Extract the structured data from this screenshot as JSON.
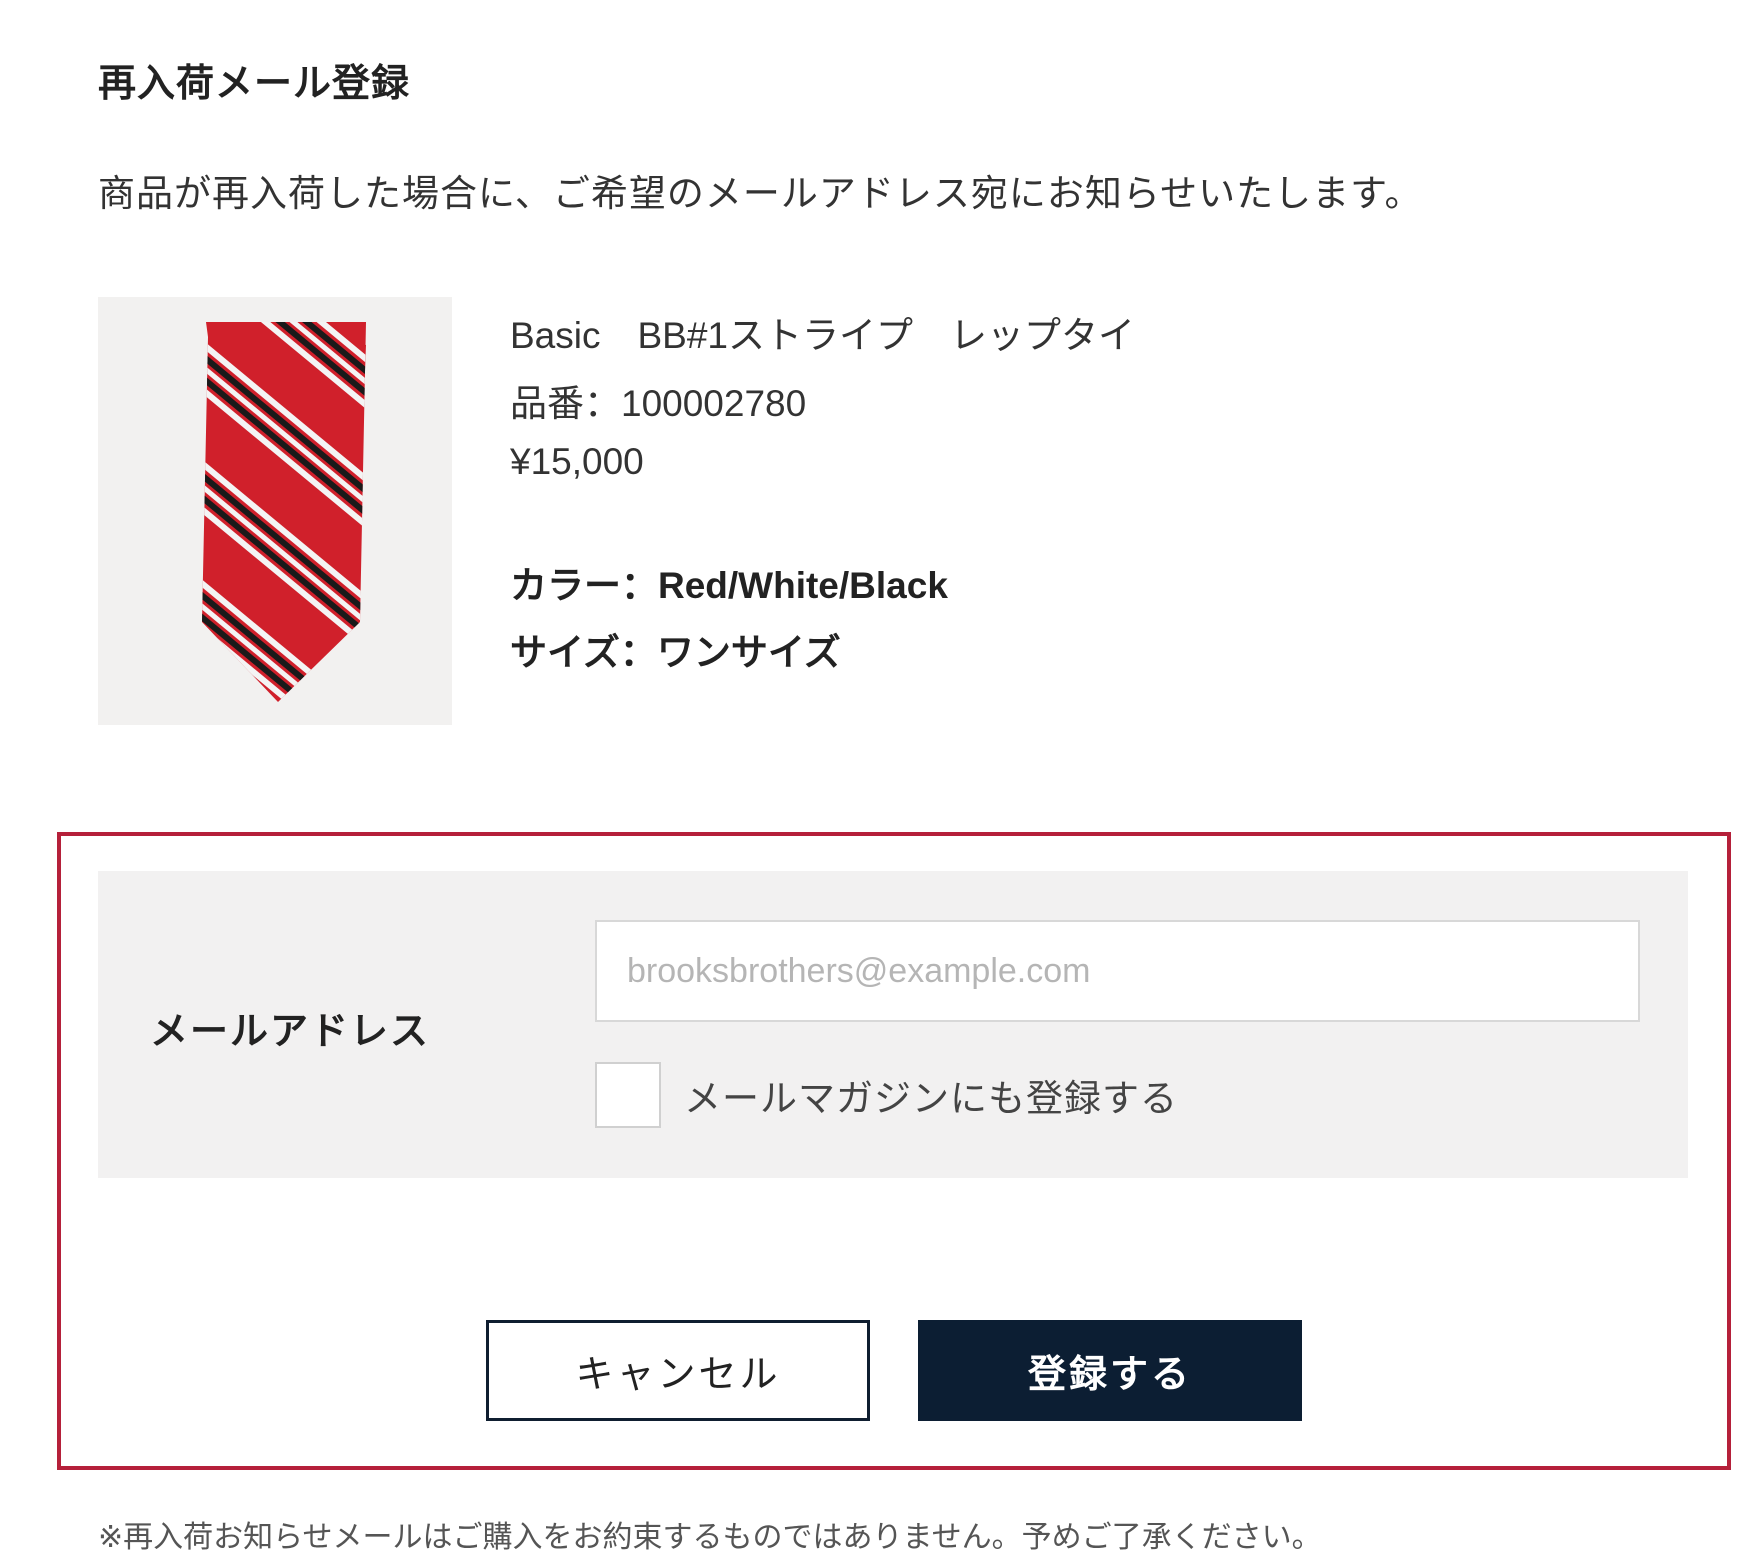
{
  "page": {
    "title": "再入荷メール登録",
    "intro": "商品が再入荷した場合に、ご希望のメールアドレス宛にお知らせいたします。"
  },
  "product": {
    "name": "Basic　BB#1ストライプ　レップタイ",
    "sku": "品番：100002780",
    "price": "¥15,000",
    "color": "カラー：Red/White/Black",
    "size": "サイズ：ワンサイズ",
    "image_icon": "striped-necktie-image"
  },
  "form": {
    "email_label": "メールアドレス",
    "email_placeholder": "brooksbrothers@example.com",
    "email_value": "",
    "newsletter_label": "メールマガジンにも登録する",
    "newsletter_checked": false
  },
  "buttons": {
    "cancel": "キャンセル",
    "submit": "登録する"
  },
  "footnote": "※再入荷お知らせメールはご購入をお約束するものではありません。予めご了承ください。",
  "colors": {
    "highlight_border": "#b5203a",
    "submit_bg": "#0c1e33",
    "panel_bg": "#f2f1f1",
    "tie_red": "#d0202b"
  }
}
